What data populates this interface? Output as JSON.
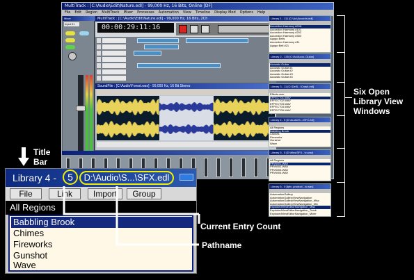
{
  "app": {
    "title": "MultiTrack : [C:\\Audio\\Edit\\Nature.edl] - 99,000 Hz, 16 Bits, Online [DF]",
    "menu": [
      "File",
      "Edit",
      "Region",
      "MultiTrack",
      "Mixer",
      "Processes",
      "Automation",
      "View",
      "Timeline",
      "Display Mod",
      "Options",
      "Help"
    ]
  },
  "mixer": {
    "title": "Mixer",
    "input_label": "Input 01"
  },
  "multitrack": {
    "title": "MultiTrack : [C:\\Audio\\Edit\\Nature.edl] - 99,000 Hz, 16 Bits, 2Ch",
    "clock": "00:00:29:11:16"
  },
  "soundfile": {
    "title": "SoundFile : [C:\\Audio\\Forest.wav] - 99,000 Hz, 16 Bit Stereo"
  },
  "libraries": [
    {
      "title": "Library 1 - 111 [C:\\Ac\\Accordn.edl]",
      "items": [
        "Accordion Harmony A018",
        "Accordion Harmony #101",
        "Accordion Harmony #202",
        "Accordion Harmony #303",
        "Agogo Bells",
        "Accordion Harmony #11",
        "Agogo Bell #21"
      ],
      "selected": 0
    },
    {
      "title": "Library 2 - 135 [C:\\Ac\\Acou..Guitar]",
      "items": [
        "Acoustic Guitar",
        "Acoustic Guitar #1",
        "Acoustic Guitar #2",
        "Acoustic Guitar #3",
        "Acoustic Guitar #4",
        "Acoustic Guitar #5"
      ],
      "selected": 0
    },
    {
      "title": "Library 3 - 11 [C:\\DeSi...\\Crash.edl]",
      "items": [
        "Effects.wav",
        "EFFECT01.WAV",
        "EFFECT02.WAV",
        "EFFECT03.WAV",
        "EFFECT04.WAV",
        "EFFECT05.WAV"
      ],
      "selected": 1
    },
    {
      "title": "Library 4 - 5 [D:\\Audio\\S...\\SFX.edl]",
      "items": [
        "All Regions",
        "Babbling Brook",
        "Chimes",
        "Fireworks",
        "Gunshot",
        "Wave"
      ],
      "selected": 1
    },
    {
      "title": "Library 5 - 5 [D:\\Mus\\SFX...\\x.wav]",
      "items": [
        "All Regions",
        "PRVW01.WAV",
        "PRVW02.WAV",
        "PRVW03.WAV",
        "PRVW04.WAV"
      ],
      "selected": 1
    },
    {
      "title": "Library 6 - 0 [fpfx_product...\\x.wav]",
      "items": [
        "AutomationGallery",
        "AutomationGalleryViewNavigation",
        "AutomationGalleryViewNavigation_Misc",
        "AutomationGalleryViewNavigation_Mix",
        "ExplodedViewEditorNavigation_Misc",
        "ExplodedViewEditorNavigation_Track",
        "ExplodedViewEditorNavigation_Mixer"
      ],
      "selected": 4
    }
  ],
  "lib_buttons": [
    "File",
    "Link",
    "Import",
    "Group"
  ],
  "zoom": {
    "title_prefix": "Library 4",
    "title_dash": " - ",
    "count": "5",
    "path": "D:\\Audio\\S...\\SFX.edl",
    "buttons": [
      "File",
      "Link",
      "Import",
      "Group"
    ],
    "header": "All Regions",
    "rows": [
      "Babbling Brook",
      "Chimes",
      "Fireworks",
      "Gunshot",
      "Wave"
    ],
    "selected_index": 0
  },
  "annotations": {
    "title_bar": "Title\nBar",
    "six_windows": "Six Open\nLibrary View\nWindows",
    "entry_count": "Current Entry Count",
    "pathname": "Pathname"
  },
  "colors": {
    "accent": "#0a246a",
    "highlight_ring": "#f0f000",
    "waveform": "#e8d25a"
  }
}
